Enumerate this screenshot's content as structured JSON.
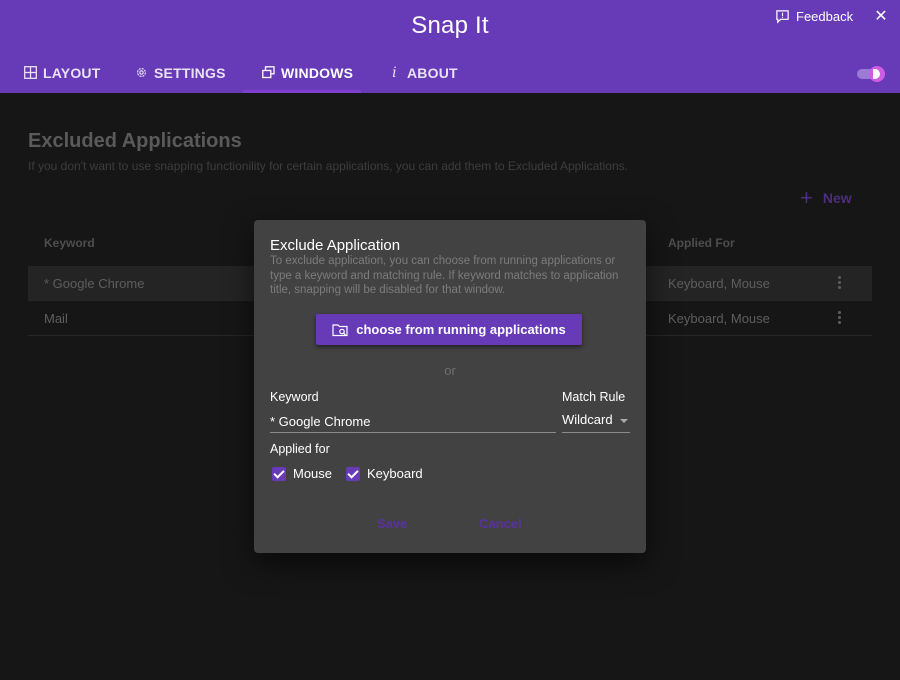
{
  "app": {
    "title": "Snap It"
  },
  "header": {
    "feedback_label": "Feedback",
    "close_glyph": "✕"
  },
  "tabs": [
    {
      "label": "LAYOUT",
      "icon": "grid-icon"
    },
    {
      "label": "SETTINGS",
      "icon": "gear-icon"
    },
    {
      "label": "WINDOWS",
      "icon": "windows-icon",
      "active": true
    },
    {
      "label": "ABOUT",
      "icon": "info-icon"
    }
  ],
  "about_glyph": "i",
  "page": {
    "title": "Excluded Applications",
    "description": "If you don't want to use snapping functionility for certain applications, you can add them to Excluded Applications.",
    "new_label": "New",
    "new_glyph": "+"
  },
  "table": {
    "headers": {
      "keyword": "Keyword",
      "applied_for": "Applied For"
    },
    "rows": [
      {
        "keyword": "* Google Chrome",
        "applied_for": "Keyboard, Mouse"
      },
      {
        "keyword": "Mail",
        "applied_for": "Keyboard, Mouse"
      }
    ]
  },
  "dialog": {
    "title": "Exclude Application",
    "description": "To exclude application, you can choose from running applications or type a keyword and matching rule. If keyword matches to application title, snapping will be disabled for that window.",
    "choose_label": "choose from running applications",
    "or_label": "or",
    "keyword_label": "Keyword",
    "keyword_value": "* Google Chrome",
    "match_rule_label": "Match Rule",
    "match_rule_value": "Wildcard",
    "applied_for_label": "Applied for",
    "checkboxes": [
      {
        "label": "Mouse",
        "checked": true
      },
      {
        "label": "Keyboard",
        "checked": true
      }
    ],
    "save_label": "Save",
    "cancel_label": "Cancel"
  },
  "colors": {
    "primary": "#673ab7",
    "background": "#161616",
    "dialog": "#424242",
    "toggle_accent": "#d05ce3"
  }
}
